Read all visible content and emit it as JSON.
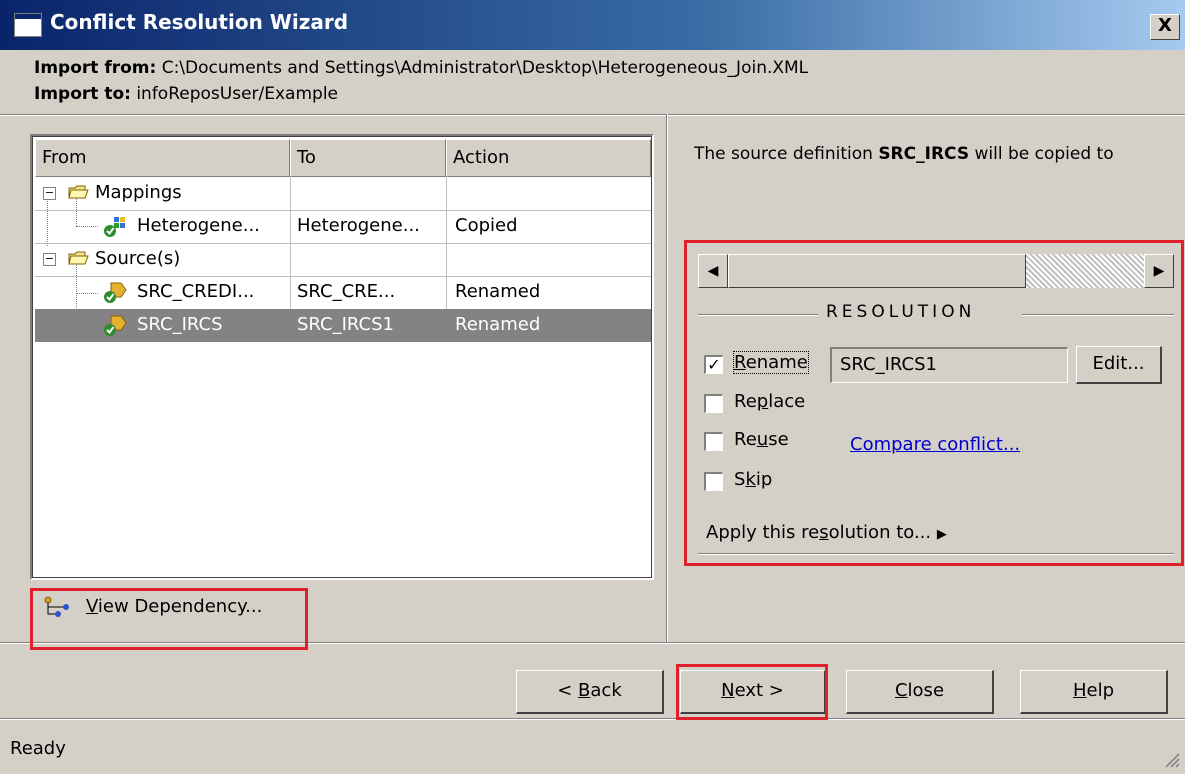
{
  "window": {
    "title": "Conflict Resolution Wizard",
    "close_glyph": "X"
  },
  "import": {
    "from_label": "Import from:",
    "from_value": "C:\\Documents and Settings\\Administrator\\Desktop\\Heterogeneous_Join.XML",
    "to_label": "Import to:",
    "to_value": "infoReposUser/Example"
  },
  "table": {
    "columns": [
      "From",
      "To",
      "Action"
    ],
    "rows": [
      {
        "from": "Mappings",
        "to": "",
        "action": "",
        "kind": "folder",
        "icon": "folder-icon",
        "expander": "−"
      },
      {
        "from": "Heterogene...",
        "to": "Heterogene...",
        "action": "Copied",
        "kind": "mapping",
        "icon": "mapping-icon"
      },
      {
        "from": "Source(s)",
        "to": "",
        "action": "",
        "kind": "folder",
        "icon": "folder-icon",
        "expander": "−"
      },
      {
        "from": "SRC_CREDI...",
        "to": "SRC_CRE...",
        "action": "Renamed",
        "kind": "source",
        "icon": "source-definition-icon"
      },
      {
        "from": "SRC_IRCS",
        "to": "SRC_IRCS1",
        "action": "Renamed",
        "kind": "source",
        "icon": "source-definition-icon",
        "selected": true
      }
    ]
  },
  "view_dependency": {
    "label_prefix": "V",
    "label_rest": "iew Dependency...",
    "icon": "dependency-icon"
  },
  "description": {
    "prefix": "The source definition ",
    "object": "SRC_IRCS",
    "suffix": " will be copied to"
  },
  "resolution": {
    "group_label": "RESOLUTION",
    "options": [
      {
        "name": "rename",
        "pre": "",
        "accel": "R",
        "post": "ename",
        "checked": true
      },
      {
        "name": "replace",
        "pre": "Re",
        "accel": "p",
        "post": "lace",
        "checked": false
      },
      {
        "name": "reuse",
        "pre": "Re",
        "accel": "u",
        "post": "se",
        "checked": false
      },
      {
        "name": "skip",
        "pre": "S",
        "accel": "k",
        "post": "ip",
        "checked": false
      }
    ],
    "rename_value": "SRC_IRCS1",
    "edit_button": "Edit...",
    "compare_link": "Compare conflict...",
    "apply_pre": "Apply this re",
    "apply_accel": "s",
    "apply_post": "olution to...",
    "apply_arrow": "▶"
  },
  "buttons": {
    "back_pre": "< ",
    "back_accel": "B",
    "back_post": "ack",
    "next_accel": "N",
    "next_post": "ext >",
    "close_accel": "C",
    "close_post": "lose",
    "help_accel": "H",
    "help_post": "elp"
  },
  "status": {
    "text": "Ready"
  },
  "colors": {
    "title_gradient_start": "#0a246a",
    "highlight_box": "#e0202a",
    "selected_row": "#848284",
    "link": "#0000cc"
  }
}
